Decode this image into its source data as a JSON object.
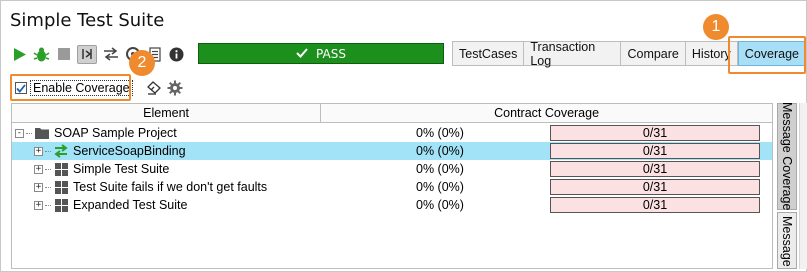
{
  "window": {
    "title": "Simple Test Suite"
  },
  "toolbar": {
    "icons": [
      "run-icon",
      "bug-icon",
      "stop-icon",
      "toggle-icon",
      "loop-icon",
      "options-icon",
      "list-icon",
      "info-icon"
    ],
    "status": {
      "text": "PASS",
      "color": "#1c8f1c"
    }
  },
  "tabs": [
    {
      "label": "TestCases",
      "active": false
    },
    {
      "label": "Transaction Log",
      "active": false
    },
    {
      "label": "Compare",
      "active": false
    },
    {
      "label": "History",
      "active": false
    },
    {
      "label": "Coverage",
      "active": true
    }
  ],
  "callouts": [
    {
      "number": "1"
    },
    {
      "number": "2"
    }
  ],
  "coverage": {
    "enable_label": "Enable Coverage",
    "enabled": true
  },
  "grid": {
    "headers": {
      "element": "Element",
      "contract": "Contract Coverage"
    },
    "rows": [
      {
        "name": "SOAP Sample Project",
        "pct": "0% (0%)",
        "bar": "0/31",
        "icon": "folder-icon",
        "expander": "-",
        "selected": false
      },
      {
        "name": "ServiceSoapBinding",
        "pct": "0% (0%)",
        "bar": "0/31",
        "icon": "interface-icon",
        "expander": "+",
        "selected": true
      },
      {
        "name": "Simple Test Suite",
        "pct": "0% (0%)",
        "bar": "0/31",
        "icon": "test-suite-icon",
        "expander": "+",
        "selected": false
      },
      {
        "name": "Test Suite fails if we don't get faults",
        "pct": "0% (0%)",
        "bar": "0/31",
        "icon": "test-suite-icon",
        "expander": "+",
        "selected": false
      },
      {
        "name": "Expanded Test Suite",
        "pct": "0% (0%)",
        "bar": "0/31",
        "icon": "test-suite-icon",
        "expander": "+",
        "selected": false
      }
    ]
  },
  "side_tabs": [
    {
      "label": "Message Coverage"
    },
    {
      "label": "Message"
    }
  ],
  "colors": {
    "accent": "#f08a2f",
    "selection": "#a3e3f7",
    "coverage_bar": "#fbe1e1",
    "active_tab": "#a9def7"
  }
}
